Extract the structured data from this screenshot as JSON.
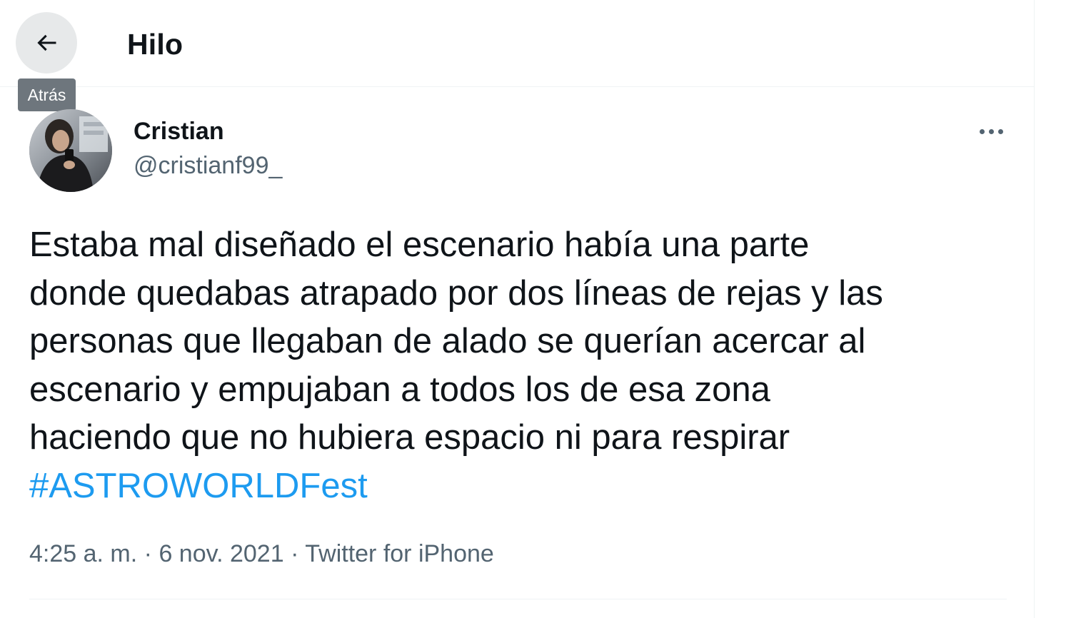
{
  "header": {
    "title": "Hilo",
    "back_icon": "arrow-left-icon",
    "back_tooltip": "Atrás"
  },
  "tweet": {
    "author": {
      "display_name": "Cristian",
      "handle": "@cristianf99_"
    },
    "more_icon": "more-horizontal-icon",
    "text_lines": [
      "Estaba mal diseñado el escenario había una parte",
      "donde quedabas atrapado por dos líneas de rejas y las",
      "personas que llegaban de alado se querían acercar al",
      "escenario y empujaban a todos los de esa zona",
      "haciendo que no hubiera espacio ni para respirar"
    ],
    "hashtag": "#ASTROWORLDFest",
    "time": "4:25 a. m.",
    "separator": "·",
    "date": "6 nov. 2021",
    "source": "Twitter for iPhone"
  },
  "colors": {
    "text": "#0f1419",
    "secondary": "#536471",
    "link": "#1d9bf0",
    "divider": "#eff3f4",
    "tooltip_bg": "#6e767d",
    "back_hover_bg": "#e7e9ea"
  }
}
